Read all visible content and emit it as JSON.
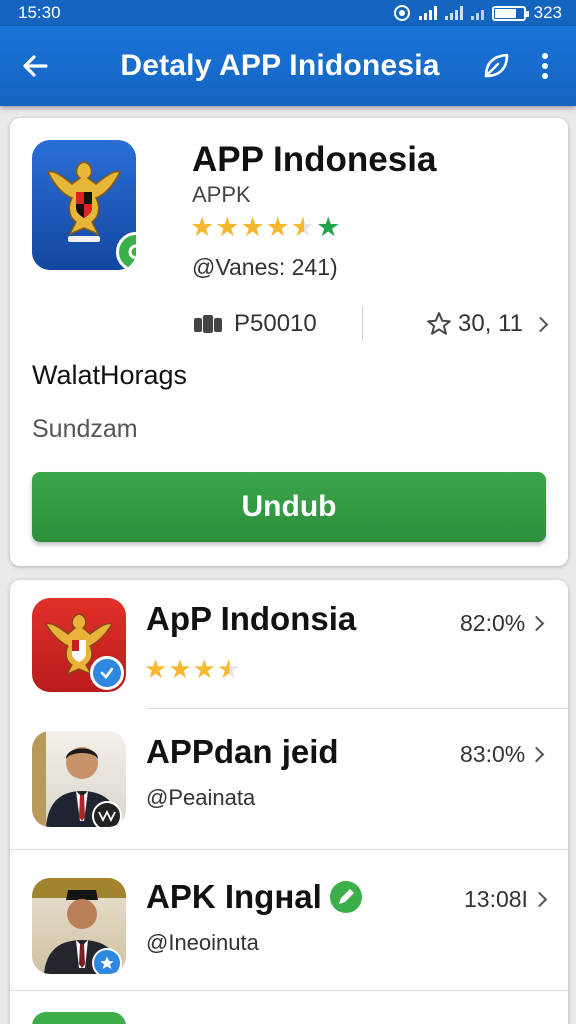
{
  "status_bar": {
    "time": "15:30",
    "battery_level": "323",
    "battery_fill": 0.75
  },
  "app_bar": {
    "title": "Detaly APP Inidonesia"
  },
  "detail": {
    "app_name": "APP Indonesia",
    "type": "APPK",
    "rating_stars": 4.5,
    "reviews": "@Vanes:  241)",
    "size_label": "P50010",
    "rating_label": "30, 11",
    "developer": "WalatHorags",
    "category": "Sundzam",
    "download_label": "Undub"
  },
  "related": [
    {
      "name": "ApP Indonsia",
      "value": "82:0%",
      "rating_stars": 3.5,
      "subtitle": ""
    },
    {
      "name": "APPdan jeid",
      "value": "83:0%",
      "subtitle": "@Peainata"
    },
    {
      "name": "APK Ingнal",
      "value": "13:08I",
      "subtitle": "@Ineoinuta"
    }
  ],
  "colors": {
    "primary": "#1565c0",
    "download": "#2d8e3c",
    "star": "#f5b82e",
    "star_green": "#21a34a"
  },
  "icons": [
    "back-arrow",
    "leaf",
    "more-vert",
    "storage",
    "star-outline",
    "chevron-right",
    "verified-check"
  ]
}
